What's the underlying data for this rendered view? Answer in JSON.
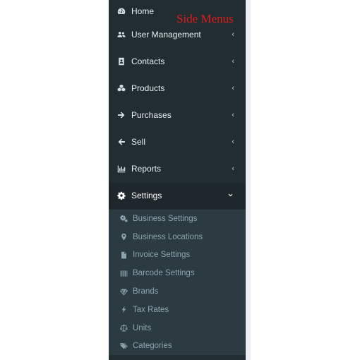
{
  "annotation": "Side Menus",
  "menu": [
    {
      "label": "Home",
      "icon": "dashboard-icon",
      "has_chevron": false
    },
    {
      "label": "User Management",
      "icon": "users-icon",
      "has_chevron": true
    },
    {
      "label": "Contacts",
      "icon": "address-book-icon",
      "has_chevron": true
    },
    {
      "label": "Products",
      "icon": "cubes-icon",
      "has_chevron": true
    },
    {
      "label": "Purchases",
      "icon": "arrow-right-icon",
      "has_chevron": true
    },
    {
      "label": "Sell",
      "icon": "arrow-left-icon",
      "has_chevron": true
    },
    {
      "label": "Reports",
      "icon": "bar-chart-icon",
      "has_chevron": true
    },
    {
      "label": "Settings",
      "icon": "gear-icon",
      "has_chevron": true,
      "expanded": true
    }
  ],
  "settings_submenu": [
    {
      "label": "Business Settings",
      "icon": "cogs-icon"
    },
    {
      "label": "Business Locations",
      "icon": "map-marker-icon"
    },
    {
      "label": "Invoice Settings",
      "icon": "file-icon"
    },
    {
      "label": "Barcode Settings",
      "icon": "barcode-icon"
    },
    {
      "label": "Brands",
      "icon": "diamond-icon"
    },
    {
      "label": "Tax Rates",
      "icon": "bolt-icon"
    },
    {
      "label": "Units",
      "icon": "balance-scale-icon"
    },
    {
      "label": "Categories",
      "icon": "tags-icon"
    }
  ],
  "chevron_collapsed": "‹",
  "chevron_expanded": "⌄",
  "colors": {
    "sidebar_bg": "#222d32",
    "active_bg": "#1e282c",
    "submenu_bg": "#2c3b41",
    "annotation": "#e01b1b"
  }
}
